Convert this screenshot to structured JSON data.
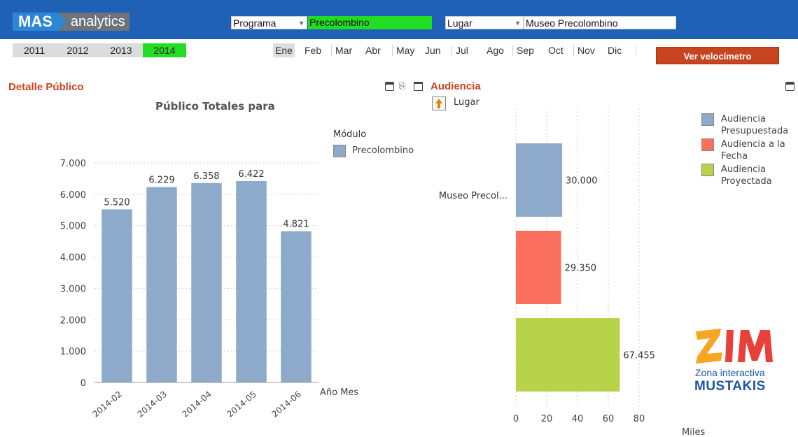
{
  "header": {
    "logo_mas": "MAS",
    "logo_analytics": "analytics",
    "programa_label": "Programa",
    "programa_value": "Precolombino",
    "lugar_label": "Lugar",
    "lugar_value": "Museo Precolombino"
  },
  "years": [
    {
      "label": "2011",
      "selected": false
    },
    {
      "label": "2012",
      "selected": false
    },
    {
      "label": "2013",
      "selected": false
    },
    {
      "label": "2014",
      "selected": true
    }
  ],
  "months": [
    {
      "label": "Ene",
      "selected": true
    },
    {
      "label": "Feb",
      "selected": false
    },
    {
      "label": "Mar",
      "selected": false
    },
    {
      "label": "Abr",
      "selected": false
    },
    {
      "label": "May",
      "selected": false
    },
    {
      "label": "Jun",
      "selected": false
    },
    {
      "label": "Jul",
      "selected": false
    },
    {
      "label": "Ago",
      "selected": false
    },
    {
      "label": "Sep",
      "selected": false
    },
    {
      "label": "Oct",
      "selected": false
    },
    {
      "label": "Nov",
      "selected": false
    },
    {
      "label": "Dic",
      "selected": false
    }
  ],
  "actions": {
    "ver_velocimetro": "Ver velocímetro"
  },
  "left_panel": {
    "title": "Detalle Público"
  },
  "right_panel": {
    "title": "Audiencia",
    "drill_label": "Lugar"
  },
  "logo_zim": {
    "text": "ZIM",
    "subtitle": "Zona interactiva",
    "brand": "MUSTAKIS"
  },
  "colors": {
    "header_bg": "#1f62b5",
    "accent": "#c8441e",
    "selected_green": "#22dd22",
    "bar_blue": "#8eaaca",
    "bar_red": "#fb6f5f",
    "bar_green": "#b8d24a"
  },
  "chart_data": [
    {
      "type": "bar",
      "title": "Público Totales para",
      "xlabel": "Año Mes",
      "ylabel": "",
      "legend_title": "Módulo",
      "legend_position": "top-right",
      "categories": [
        "2014-02",
        "2014-03",
        "2014-04",
        "2014-05",
        "2014-06"
      ],
      "series": [
        {
          "name": "Precolombino",
          "values": [
            5520,
            6229,
            6358,
            6422,
            4821
          ],
          "color": "#8eaaca"
        }
      ],
      "value_labels": [
        "5.520",
        "6.229",
        "6.358",
        "6.422",
        "4.821"
      ],
      "y_ticks": [
        "0",
        "1.000",
        "2.000",
        "3.000",
        "4.000",
        "5.000",
        "6.000",
        "7.000"
      ],
      "ylim": [
        0,
        7000
      ],
      "grid": true
    },
    {
      "type": "bar",
      "orientation": "horizontal",
      "xlabel": "Miles",
      "ylabel": "",
      "legend_position": "top-right",
      "categories": [
        "Museo Precol..."
      ],
      "series": [
        {
          "name": "Audiencia Presupuestada",
          "values": [
            30.0
          ],
          "label": "30.000",
          "color": "#8eaaca"
        },
        {
          "name": "Audiencia a la Fecha",
          "values": [
            29.35
          ],
          "label": "29.350",
          "color": "#fb6f5f"
        },
        {
          "name": "Audiencia Proyectada",
          "values": [
            67.455
          ],
          "label": "67.455",
          "color": "#b8d24a"
        }
      ],
      "x_ticks": [
        "0",
        "20",
        "40",
        "60",
        "80"
      ],
      "xlim": [
        0,
        90
      ],
      "grid": true
    }
  ]
}
